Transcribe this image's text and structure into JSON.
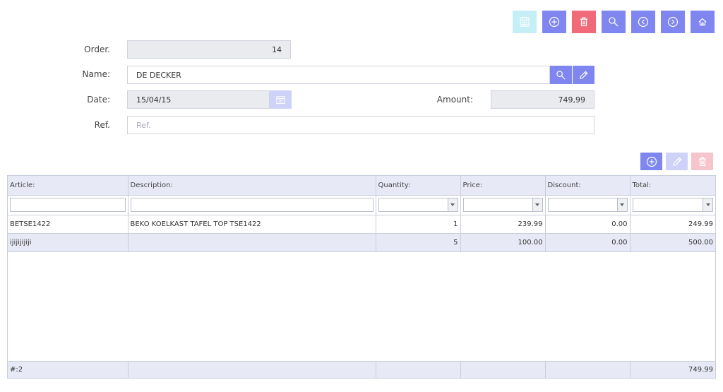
{
  "toolbar": {
    "buttons": [
      {
        "name": "save",
        "icon": "save-icon",
        "state": "disabled"
      },
      {
        "name": "add",
        "icon": "plus-circle-icon",
        "state": "enabled"
      },
      {
        "name": "delete",
        "icon": "trash-icon",
        "state": "enabled"
      },
      {
        "name": "search",
        "icon": "search-icon",
        "state": "enabled"
      },
      {
        "name": "previous",
        "icon": "chevron-left-circle-icon",
        "state": "enabled"
      },
      {
        "name": "next",
        "icon": "chevron-right-circle-icon",
        "state": "enabled"
      },
      {
        "name": "home",
        "icon": "home-icon",
        "state": "enabled"
      }
    ]
  },
  "form": {
    "order": {
      "label": "Order.",
      "value": "14"
    },
    "name": {
      "label": "Name:",
      "value": "DE DECKER"
    },
    "date": {
      "label": "Date:",
      "value": "15/04/15"
    },
    "amount": {
      "label": "Amount:",
      "value": "749,99"
    },
    "ref": {
      "label": "Ref.",
      "placeholder": "Ref.",
      "value": ""
    }
  },
  "grid": {
    "columns": [
      "Article:",
      "Description:",
      "Quantity:",
      "Price:",
      "Discount:",
      "Total:"
    ],
    "rows": [
      {
        "article": "BETSE1422",
        "description": "BEKO KOELKAST TAFEL TOP TSE1422",
        "quantity": "1",
        "price": "239.99",
        "discount": "0.00",
        "total": "249.99"
      },
      {
        "article": "ijijijijiji",
        "description": "",
        "quantity": "5",
        "price": "100.00",
        "discount": "0.00",
        "total": "500.00"
      }
    ],
    "footer": {
      "count": "#:2",
      "total": "749.99"
    }
  },
  "colors": {
    "accent": "#7f86ef",
    "danger": "#f06a7a",
    "disabled_save": "#c6eef6",
    "row_alt": "#e7eaf6"
  }
}
